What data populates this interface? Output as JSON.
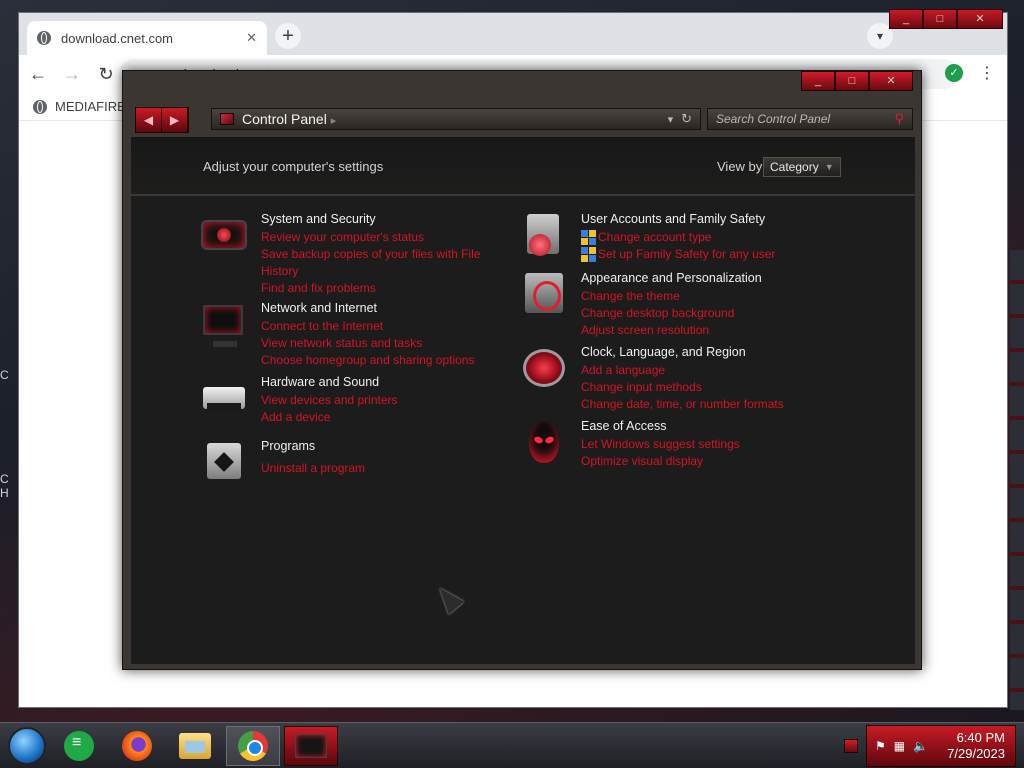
{
  "desktop": {
    "left_text_1": "C",
    "left_text_2": "C",
    "left_text_3": "H"
  },
  "browser": {
    "tab_title": "download.cnet.com",
    "tab_close": "✕",
    "new_tab": "+",
    "address": "download.cnet.com",
    "bookmark_label": "MEDIAFIRE F"
  },
  "control_panel": {
    "breadcrumb": "Control Panel",
    "search_placeholder": "Search Control Panel",
    "header_text": "Adjust your computer's settings",
    "view_by_label": "View by:",
    "view_by_value": "Category",
    "accent_color": "#d41424",
    "categories_left": [
      {
        "title": "System and Security",
        "icon": "shield-icon",
        "links": [
          "Review your computer's status",
          "Save backup copies of your files with File History",
          "Find and fix problems"
        ]
      },
      {
        "title": "Network and Internet",
        "icon": "network-icon",
        "links": [
          "Connect to the Internet",
          "View network status and tasks",
          "Choose homegroup and sharing options"
        ]
      },
      {
        "title": "Hardware and Sound",
        "icon": "hardware-icon",
        "links": [
          "View devices and printers",
          "Add a device"
        ]
      },
      {
        "title": "Programs",
        "icon": "programs-icon",
        "links": [
          "Uninstall a program"
        ]
      }
    ],
    "categories_right": [
      {
        "title": "User Accounts and Family Safety",
        "icon": "user-accounts-icon",
        "links": [
          "Change account type",
          "Set up Family Safety for any user"
        ]
      },
      {
        "title": "Appearance and Personalization",
        "icon": "appearance-icon",
        "links": [
          "Change the theme",
          "Change desktop background",
          "Adjust screen resolution"
        ]
      },
      {
        "title": "Clock, Language, and Region",
        "icon": "globe-icon",
        "links": [
          "Add a language",
          "Change input methods",
          "Change date, time, or number formats"
        ]
      },
      {
        "title": "Ease of Access",
        "icon": "ease-of-access-icon",
        "links": [
          "Let Windows suggest settings",
          "Optimize visual display"
        ]
      }
    ]
  },
  "taskbar": {
    "time": "6:40 PM",
    "date": "7/29/2023"
  }
}
